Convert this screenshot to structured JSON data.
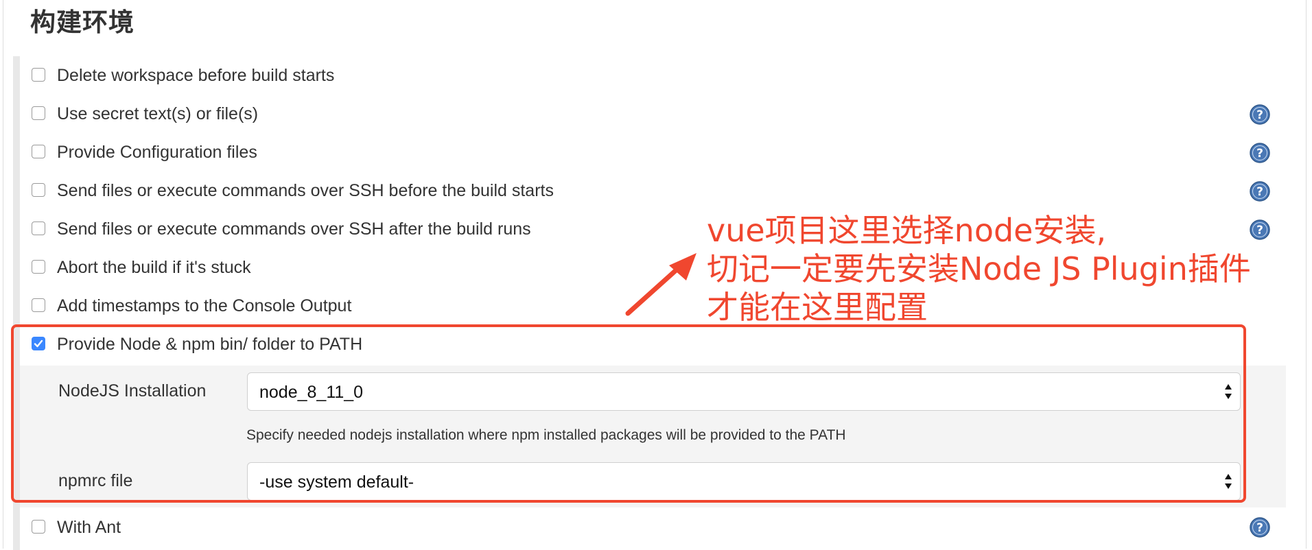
{
  "section": {
    "title": "构建环境"
  },
  "options": [
    {
      "label": "Delete workspace before build starts",
      "checked": false,
      "help": false
    },
    {
      "label": "Use secret text(s) or file(s)",
      "checked": false,
      "help": true
    },
    {
      "label": "Provide Configuration files",
      "checked": false,
      "help": true
    },
    {
      "label": "Send files or execute commands over SSH before the build starts",
      "checked": false,
      "help": true
    },
    {
      "label": "Send files or execute commands over SSH after the build runs",
      "checked": false,
      "help": true
    },
    {
      "label": "Abort the build if it's stuck",
      "checked": false,
      "help": false
    },
    {
      "label": "Add timestamps to the Console Output",
      "checked": false,
      "help": false
    },
    {
      "label": "Provide Node & npm bin/ folder to PATH",
      "checked": true,
      "help": false
    },
    {
      "label": "With Ant",
      "checked": false,
      "help": true
    }
  ],
  "node": {
    "installation_label": "NodeJS Installation",
    "installation_value": "node_8_11_0",
    "installation_hint": "Specify needed nodejs installation where npm installed packages will be provided to the PATH",
    "npmrc_label": "npmrc file",
    "npmrc_value": "-use system default-"
  },
  "annotation": {
    "lines": [
      "vue项目这里选择node安装,",
      "切记一定要先安装Node JS Plugin插件",
      "才能在这里配置"
    ],
    "color": "#f0472f"
  },
  "colors": {
    "checkbox_checked": "#3a87ff",
    "help_icon": "#4a78b5"
  }
}
